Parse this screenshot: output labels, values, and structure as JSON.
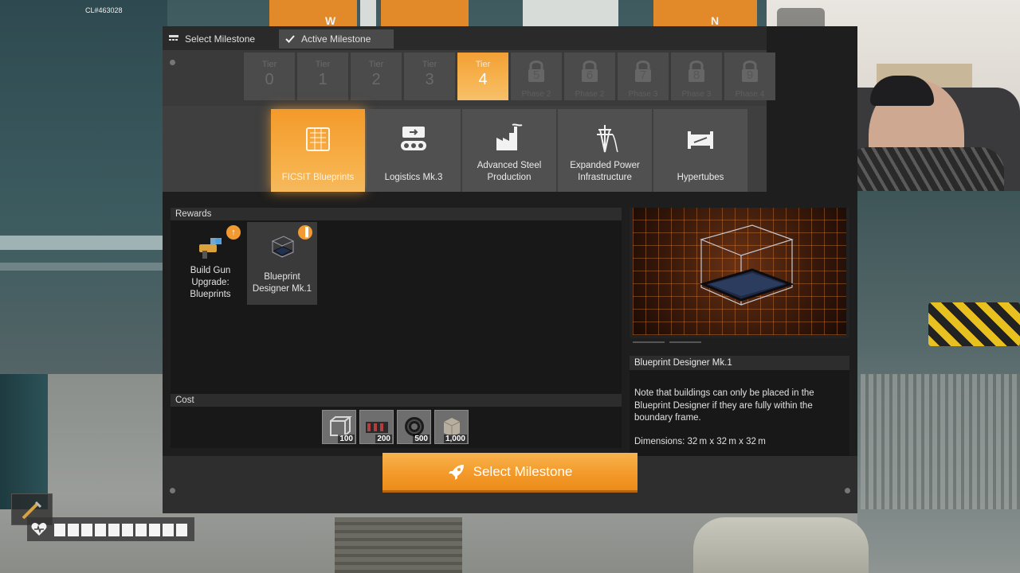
{
  "hud_top": {
    "build_id": "CL#463028",
    "compass": [
      "W",
      "N"
    ]
  },
  "tabs": {
    "select": "Select Milestone",
    "active": "Active Milestone"
  },
  "tiers": [
    {
      "label": "Tier",
      "num": "0",
      "state": "available"
    },
    {
      "label": "Tier",
      "num": "1",
      "state": "available"
    },
    {
      "label": "Tier",
      "num": "2",
      "state": "available"
    },
    {
      "label": "Tier",
      "num": "3",
      "state": "available"
    },
    {
      "label": "Tier",
      "num": "4",
      "state": "selected"
    },
    {
      "label": "Phase 2",
      "num": "5",
      "state": "locked"
    },
    {
      "label": "Phase 2",
      "num": "6",
      "state": "locked"
    },
    {
      "label": "Phase 3",
      "num": "7",
      "state": "locked"
    },
    {
      "label": "Phase 3",
      "num": "8",
      "state": "locked"
    },
    {
      "label": "Phase 4",
      "num": "9",
      "state": "locked"
    }
  ],
  "milestones": [
    {
      "label": "FICSIT Blueprints",
      "icon": "blueprint-icon",
      "selected": true
    },
    {
      "label": "Logistics Mk.3",
      "icon": "conveyor-icon",
      "selected": false
    },
    {
      "label": "Advanced Steel Production",
      "icon": "factory-icon",
      "selected": false
    },
    {
      "label": "Expanded Power Infrastructure",
      "icon": "power-pole-icon",
      "selected": false
    },
    {
      "label": "Hypertubes",
      "icon": "hypertube-icon",
      "selected": false
    }
  ],
  "rewards": {
    "title": "Rewards",
    "items": [
      {
        "label": "Build Gun Upgrade: Blueprints",
        "icon": "build-gun-icon",
        "badge": "upgrade-arrow-icon"
      },
      {
        "label": "Blueprint Designer Mk.1",
        "icon": "blueprint-designer-icon",
        "badge": "factory-badge-icon"
      }
    ]
  },
  "cost": {
    "title": "Cost",
    "items": [
      {
        "icon": "modular-frame-icon",
        "amount": "100"
      },
      {
        "icon": "rotor-icon",
        "amount": "200"
      },
      {
        "icon": "cable-icon",
        "amount": "500"
      },
      {
        "icon": "concrete-icon",
        "amount": "1,000"
      }
    ]
  },
  "detail": {
    "title": "Blueprint Designer Mk.1",
    "description": "Note that buildings can only be placed in the Blueprint Designer if they are fully within the boundary frame.",
    "dimensions": "Dimensions: 32 m x 32 m x 32 m"
  },
  "action": {
    "select_button": "Select Milestone"
  },
  "colors": {
    "accent": "#f39a2a",
    "panel": "#1e1e1e",
    "locked": "#4b4b4b"
  },
  "health": {
    "segments_total": 10,
    "segments_filled": 10
  }
}
